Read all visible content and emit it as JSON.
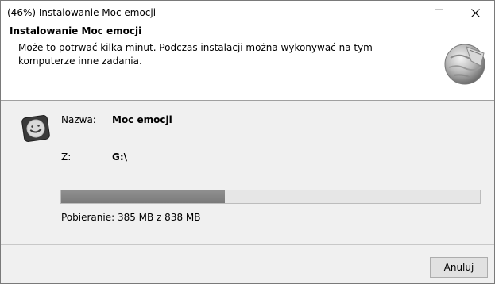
{
  "window": {
    "title": "(46%) Instalowanie Moc emocji"
  },
  "header": {
    "title": "Instalowanie Moc emocji",
    "description": "Może to potrwać kilka minut. Podczas instalacji można wykonywać na tym komputerze inne zadania."
  },
  "details": {
    "name_label": "Nazwa:",
    "name_value": "Moc emocji",
    "from_label": "Z:",
    "from_value": "G:\\"
  },
  "progress": {
    "fraction": 0.39,
    "status": "Pobieranie: 385 MB z 838 MB"
  },
  "footer": {
    "cancel_label": "Anuluj"
  },
  "icons": {
    "header": "installer-globe-icon",
    "app": "smile-app-icon",
    "minimize": "minimize-icon",
    "maximize": "maximize-icon",
    "close": "close-icon"
  }
}
